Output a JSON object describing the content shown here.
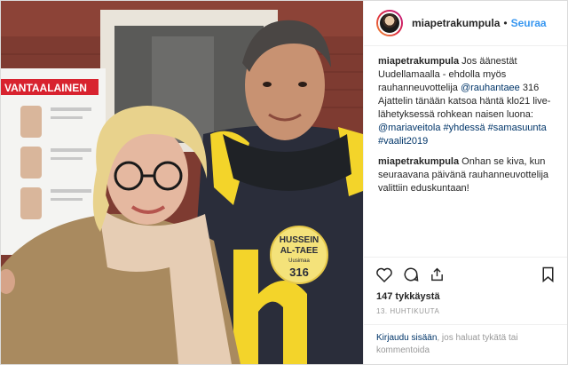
{
  "header": {
    "username": "miapetrakumpula",
    "separator": "•",
    "follow_label": "Seuraa"
  },
  "photo": {
    "sign_title": "VANTAALAINEN",
    "badge": {
      "name_line1": "HUSSEIN",
      "name_line2": "AL-TAEE",
      "party": "Uusimaa",
      "number": "316"
    }
  },
  "caption": {
    "username": "miapetrakumpula",
    "text1": "Jos äänestät Uudellamaalla - ehdolla myös rauhanneuvottelija",
    "mention1": "@rauhantaee",
    "text2": "316 Ajattelin tänään katsoa häntä klo21 live-lähetyksessä rohkean naisen luona:",
    "mention2": "@mariaveitola",
    "hashtags": "#yhdessä #samasuunta #vaalit2019"
  },
  "comment": {
    "username": "miapetrakumpula",
    "text": "Onhan se kiva, kun seuraavana päivänä rauhanneuvottelija valittiin eduskuntaan!"
  },
  "actions": {
    "likes": "147 tykkäystä",
    "date": "13. huhtikuuta"
  },
  "login": {
    "link": "Kirjaudu sisään",
    "text": ", jos haluat tykätä tai kommentoida"
  },
  "icons": [
    "heart-icon",
    "comment-icon",
    "share-icon",
    "bookmark-icon"
  ]
}
